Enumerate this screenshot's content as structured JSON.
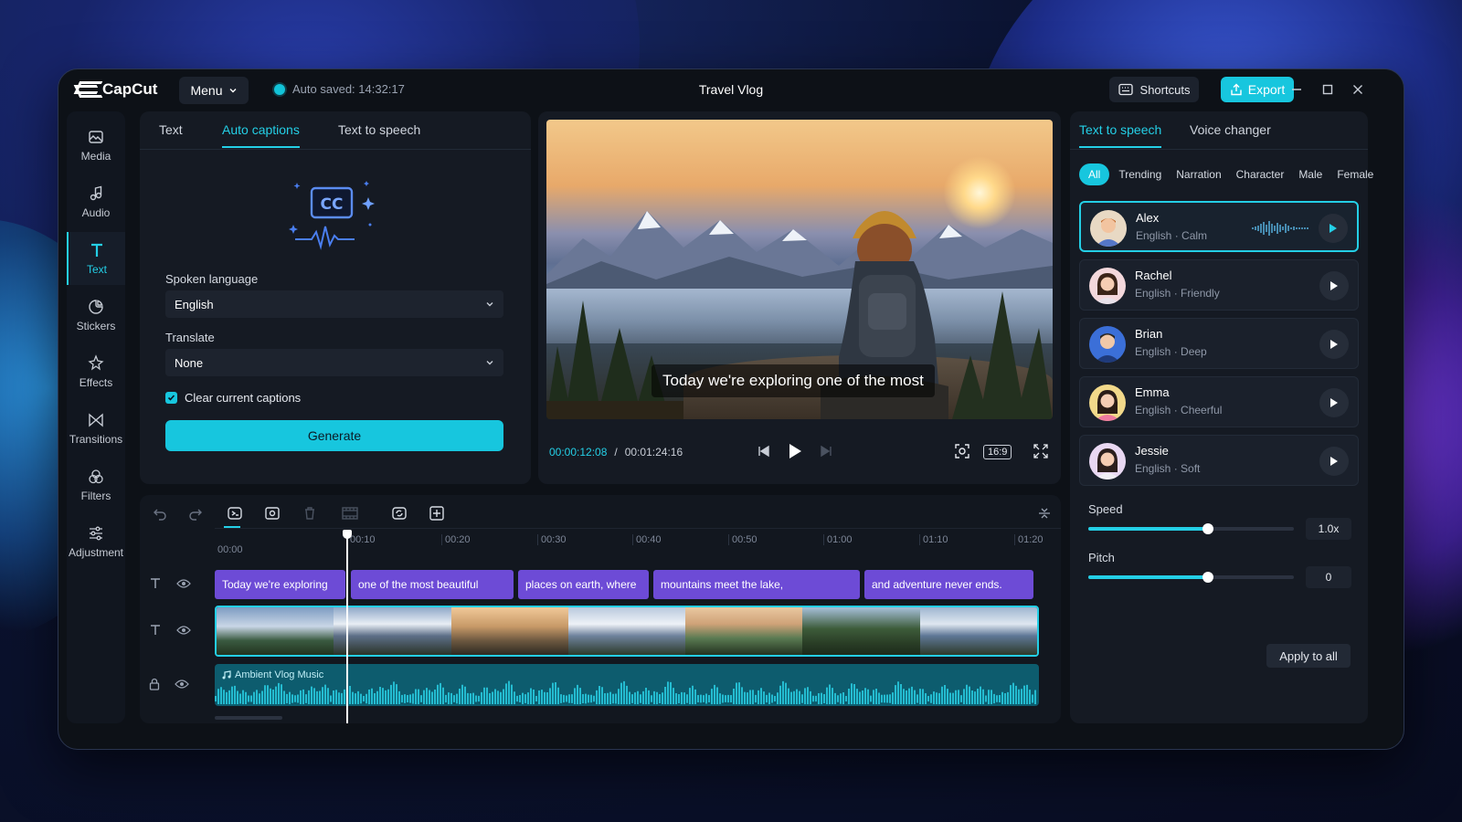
{
  "app": {
    "brand": "CapCut",
    "menu_label": "Menu",
    "autosave": "Auto saved: 14:32:17",
    "project_title": "Travel Vlog",
    "shortcuts_label": "Shortcuts",
    "export_label": "Export"
  },
  "colors": {
    "accent": "#17c6de",
    "caption_clip": "#6d4bd6",
    "audio_clip": "#0d5c6e"
  },
  "leftnav": {
    "items": [
      {
        "label": "Media",
        "icon": "media-icon"
      },
      {
        "label": "Audio",
        "icon": "audio-icon"
      },
      {
        "label": "Text",
        "icon": "text-icon",
        "active": true
      },
      {
        "label": "Stickers",
        "icon": "stickers-icon"
      },
      {
        "label": "Effects",
        "icon": "effects-icon"
      },
      {
        "label": "Transitions",
        "icon": "transitions-icon"
      },
      {
        "label": "Filters",
        "icon": "filters-icon"
      },
      {
        "label": "Adjustment",
        "icon": "adjustment-icon"
      }
    ]
  },
  "captions": {
    "tabs": [
      "Text",
      "Auto captions",
      "Text to speech"
    ],
    "active_tab": "Auto captions",
    "cc_text": "CC",
    "spoken_language_label": "Spoken language",
    "spoken_language_value": "English",
    "translate_label": "Translate",
    "translate_value": "None",
    "clear_label": "Clear current captions",
    "clear_checked": true,
    "generate_label": "Generate"
  },
  "preview": {
    "subtitle": "Today we're exploring one of the most",
    "current_time": "00:00:12:08",
    "separator": "/",
    "total_time": "00:01:24:16",
    "ratio": "16:9"
  },
  "tts": {
    "tabs": [
      "Text to speech",
      "Voice changer"
    ],
    "active_tab": "Text to speech",
    "chips": [
      "All",
      "Trending",
      "Narration",
      "Character",
      "Male",
      "Female"
    ],
    "active_chip": "All",
    "voices": [
      {
        "name": "Alex",
        "desc": "English · Calm",
        "active": true
      },
      {
        "name": "Rachel",
        "desc": "English · Friendly"
      },
      {
        "name": "Brian",
        "desc": "English · Deep"
      },
      {
        "name": "Emma",
        "desc": "English · Cheerful"
      },
      {
        "name": "Jessie",
        "desc": "English · Soft"
      }
    ],
    "speed_label": "Speed",
    "speed_value": "1.0x",
    "speed_fraction": 0.58,
    "pitch_label": "Pitch",
    "pitch_value": "0",
    "pitch_fraction": 0.58,
    "apply_label": "Apply to all"
  },
  "timeline": {
    "start_time": "00:00",
    "ticks": [
      "00:10",
      "00:20",
      "00:30",
      "00:40",
      "00:50",
      "01:00",
      "01:10",
      "01:20"
    ],
    "caption_clips": [
      "Today we're exploring",
      "one of the most beautiful",
      "places on earth, where",
      "mountains meet the lake,",
      "and adventure never ends."
    ],
    "audio_name": "Ambient Vlog Music"
  }
}
